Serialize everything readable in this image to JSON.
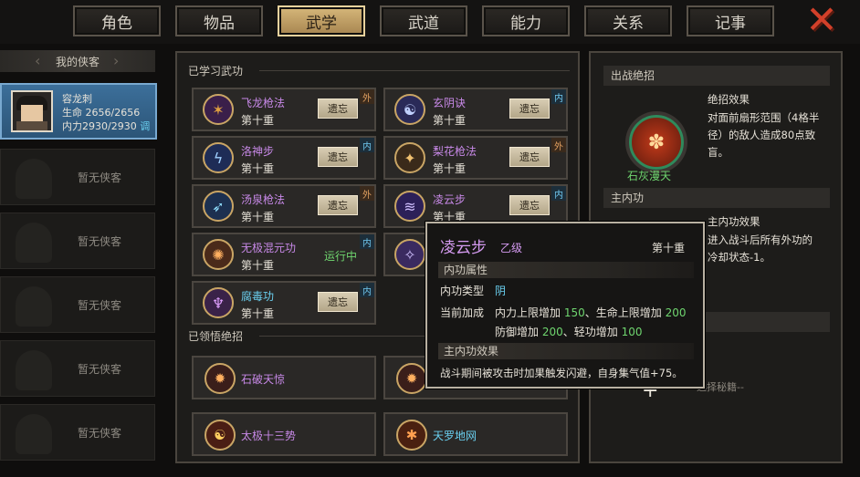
{
  "tabs": [
    "角色",
    "物品",
    "武学",
    "武道",
    "能力",
    "关系",
    "记事"
  ],
  "active_tab": "武学",
  "roster": {
    "header": "我的侠客",
    "hero": {
      "name": "容龙刺",
      "hp_label": "生命",
      "hp": "2656/2656",
      "mp_label": "内力",
      "mp": "2930/2930",
      "tag": "调"
    },
    "empty_label": "暂无侠客"
  },
  "learned": {
    "title": "已学习武功",
    "skills": [
      {
        "name": "飞龙枪法",
        "level": "第十重",
        "action": "遗忘",
        "tag": "外",
        "color": "purple"
      },
      {
        "name": "玄阴诀",
        "level": "第十重",
        "action": "遗忘",
        "tag": "内",
        "color": "purple"
      },
      {
        "name": "洛神步",
        "level": "第十重",
        "action": "遗忘",
        "tag": "内",
        "color": "purple"
      },
      {
        "name": "梨花枪法",
        "level": "第十重",
        "action": "遗忘",
        "tag": "外",
        "color": "purple"
      },
      {
        "name": "汤泉枪法",
        "level": "第十重",
        "action": "遗忘",
        "tag": "外",
        "color": "purple"
      },
      {
        "name": "凌云步",
        "level": "第十重",
        "action": "遗忘",
        "tag": "内",
        "color": "purple"
      },
      {
        "name": "无极混元功",
        "level": "第十重",
        "action": "运行中",
        "tag": "内",
        "color": "purple"
      },
      {
        "name": "腐毒功",
        "level": "第十重",
        "action": "遗忘",
        "tag": "内",
        "color": "blue"
      }
    ]
  },
  "ultimates": {
    "title": "已领悟绝招",
    "items": [
      {
        "name": "石破天惊",
        "color": "purple"
      },
      {
        "name": "太极十三势",
        "color": "purple"
      },
      {
        "name": "天罗地网",
        "color": "blue"
      }
    ]
  },
  "right": {
    "fight_header": "出战绝招",
    "fight_name": "石灰漫天",
    "effect_title": "绝招效果",
    "effect_text": [
      "对面前扇形范围（4格半",
      "径）的敌人造成80点致",
      "盲。"
    ],
    "inner_header": "主内功",
    "inner_effect_title": "主内功效果",
    "inner_effect_text": [
      "进入战斗后所有外功的",
      "冷却状态-1。"
    ],
    "select_label": "--选择秘籍--"
  },
  "tooltip": {
    "name": "凌云步",
    "grade": "乙级",
    "level": "第十重",
    "attr_header": "内功属性",
    "type_label": "内功类型",
    "type_value": "阴",
    "bonus_label": "当前加成",
    "bonus_1a": "内力上限增加",
    "bonus_1b": "150",
    "bonus_1c": "、生命上限增加",
    "bonus_1d": "200",
    "bonus_2a": "防御增加",
    "bonus_2b": "200",
    "bonus_2c": "、轻功增加",
    "bonus_2d": "100",
    "effect_header": "主内功效果",
    "effect_text": "战斗期间被攻击时加果触发闪避，自身集气值+75。"
  },
  "colors": {
    "accent": "#c9a565",
    "purple": "#c889e8",
    "blue": "#6ad0f0",
    "green": "#6fd56f",
    "out_tag": "#e2a060",
    "in_tag": "#70c8f0"
  }
}
